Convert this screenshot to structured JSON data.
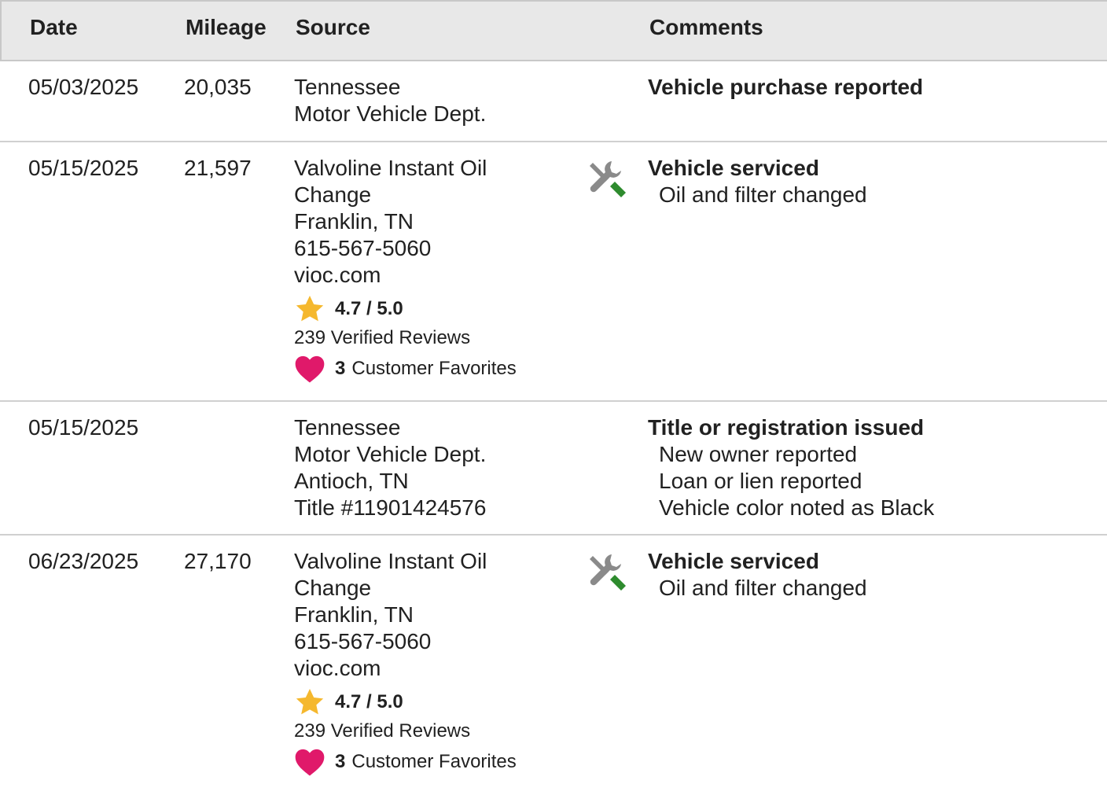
{
  "header": {
    "date": "Date",
    "mileage": "Mileage",
    "source": "Source",
    "comments": "Comments"
  },
  "rows": [
    {
      "date": "05/03/2025",
      "mileage": "20,035",
      "source": [
        "Tennessee",
        "Motor Vehicle Dept."
      ],
      "comment_title": "Vehicle purchase reported",
      "comment_items": []
    },
    {
      "date": "05/15/2025",
      "mileage": "21,597",
      "source": [
        "Valvoline Instant Oil",
        "Change",
        "Franklin, TN",
        "615-567-5060",
        "vioc.com"
      ],
      "icon": "service-tools-icon",
      "rating": "4.7 / 5.0",
      "reviews": "239 Verified Reviews",
      "favorites_count": "3",
      "favorites_label": "Customer Favorites",
      "comment_title": "Vehicle serviced",
      "comment_items": [
        "Oil and filter changed"
      ]
    },
    {
      "date": "05/15/2025",
      "mileage": "",
      "source": [
        "Tennessee",
        "Motor Vehicle Dept.",
        "Antioch, TN",
        "Title #11901424576"
      ],
      "comment_title": "Title or registration issued",
      "comment_items": [
        "New owner reported",
        "Loan or lien reported",
        "Vehicle color noted as Black"
      ]
    },
    {
      "date": "06/23/2025",
      "mileage": "27,170",
      "source": [
        "Valvoline Instant Oil",
        "Change",
        "Franklin, TN",
        "615-567-5060",
        "vioc.com"
      ],
      "icon": "service-tools-icon",
      "rating": "4.7 / 5.0",
      "reviews": "239 Verified Reviews",
      "favorites_count": "3",
      "favorites_label": "Customer Favorites",
      "comment_title": "Vehicle serviced",
      "comment_items": [
        "Oil and filter changed"
      ]
    }
  ],
  "colors": {
    "header_bg": "#e8e8e8",
    "star": "#f5b82e",
    "heart": "#e0196a",
    "tool_gray": "#8a8a8a",
    "tool_green": "#2e8b2e"
  }
}
